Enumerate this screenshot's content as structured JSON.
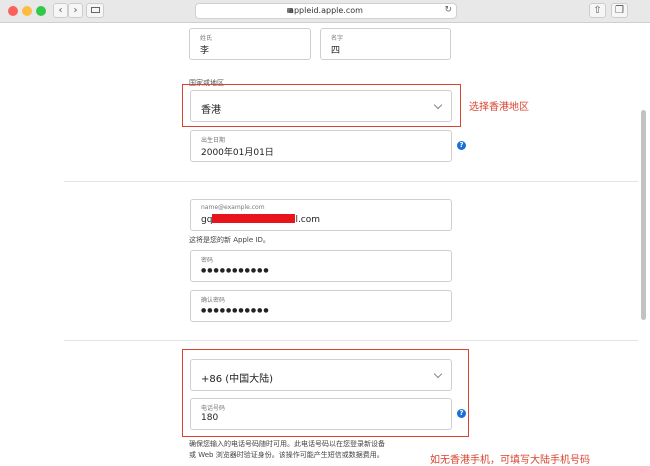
{
  "browser": {
    "url": "appleid.apple.com",
    "colors": {
      "close": "#fc605b",
      "minimize": "#fdbc40",
      "maximize": "#34c84a"
    }
  },
  "form": {
    "last_name": {
      "label": "姓氏",
      "value": "李"
    },
    "first_name": {
      "label": "名字",
      "value": "四"
    },
    "country": {
      "label": "国家或地区",
      "value": "香港"
    },
    "birthday": {
      "label": "出生日期",
      "value": "2000年01月01日"
    },
    "email": {
      "placeholder": "name@example.com",
      "value_prefix": "gq",
      "value_suffix": "l.com",
      "note": "这将是您的新 Apple ID。"
    },
    "password": {
      "label": "密码",
      "value": "●●●●●●●●●●●"
    },
    "confirm_password": {
      "label": "确认密码",
      "value": "●●●●●●●●●●●"
    },
    "phone_code": {
      "value": "+86 (中国大陆)"
    },
    "phone": {
      "label": "电话号码",
      "value": "180"
    },
    "phone_note_line1": "确保您输入的电话号码随时可用。此电话号码以在您登录新设备",
    "phone_note_line2": "或 Web 浏览器时验证身份。该操作可能产生短信或数据费用。"
  },
  "annotations": {
    "country_tip": "选择香港地区",
    "phone_tip": "如无香港手机，可填写大陆手机号码"
  },
  "help_icon": "?"
}
